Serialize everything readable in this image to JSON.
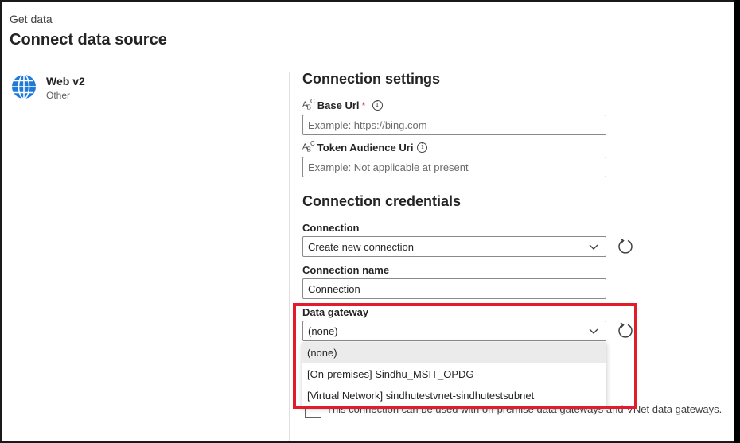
{
  "header": {
    "eyebrow": "Get data",
    "title": "Connect data source"
  },
  "source": {
    "name": "Web v2",
    "category": "Other",
    "icon": "globe-icon"
  },
  "connection_settings": {
    "title": "Connection settings",
    "base_url": {
      "label": "Base Url",
      "required_mark": "*",
      "placeholder": "Example: https://bing.com"
    },
    "token_audience_uri": {
      "label": "Token Audience Uri",
      "placeholder": "Example: Not applicable at present"
    }
  },
  "connection_credentials": {
    "title": "Connection credentials",
    "connection": {
      "label": "Connection",
      "value": "Create new connection"
    },
    "connection_name": {
      "label": "Connection name",
      "value": "Connection"
    },
    "data_gateway": {
      "label": "Data gateway",
      "value": "(none)",
      "options": [
        "(none)",
        "[On-premises] Sindhu_MSIT_OPDG",
        "[Virtual Network] sindhutestvnet-sindhutestsubnet"
      ]
    },
    "gateway_checkbox_label": "This connection can be used with on-premise data gateways and VNet data gateways."
  },
  "colors": {
    "highlight": "#e21c2b",
    "globe": "#1f7ad8"
  }
}
